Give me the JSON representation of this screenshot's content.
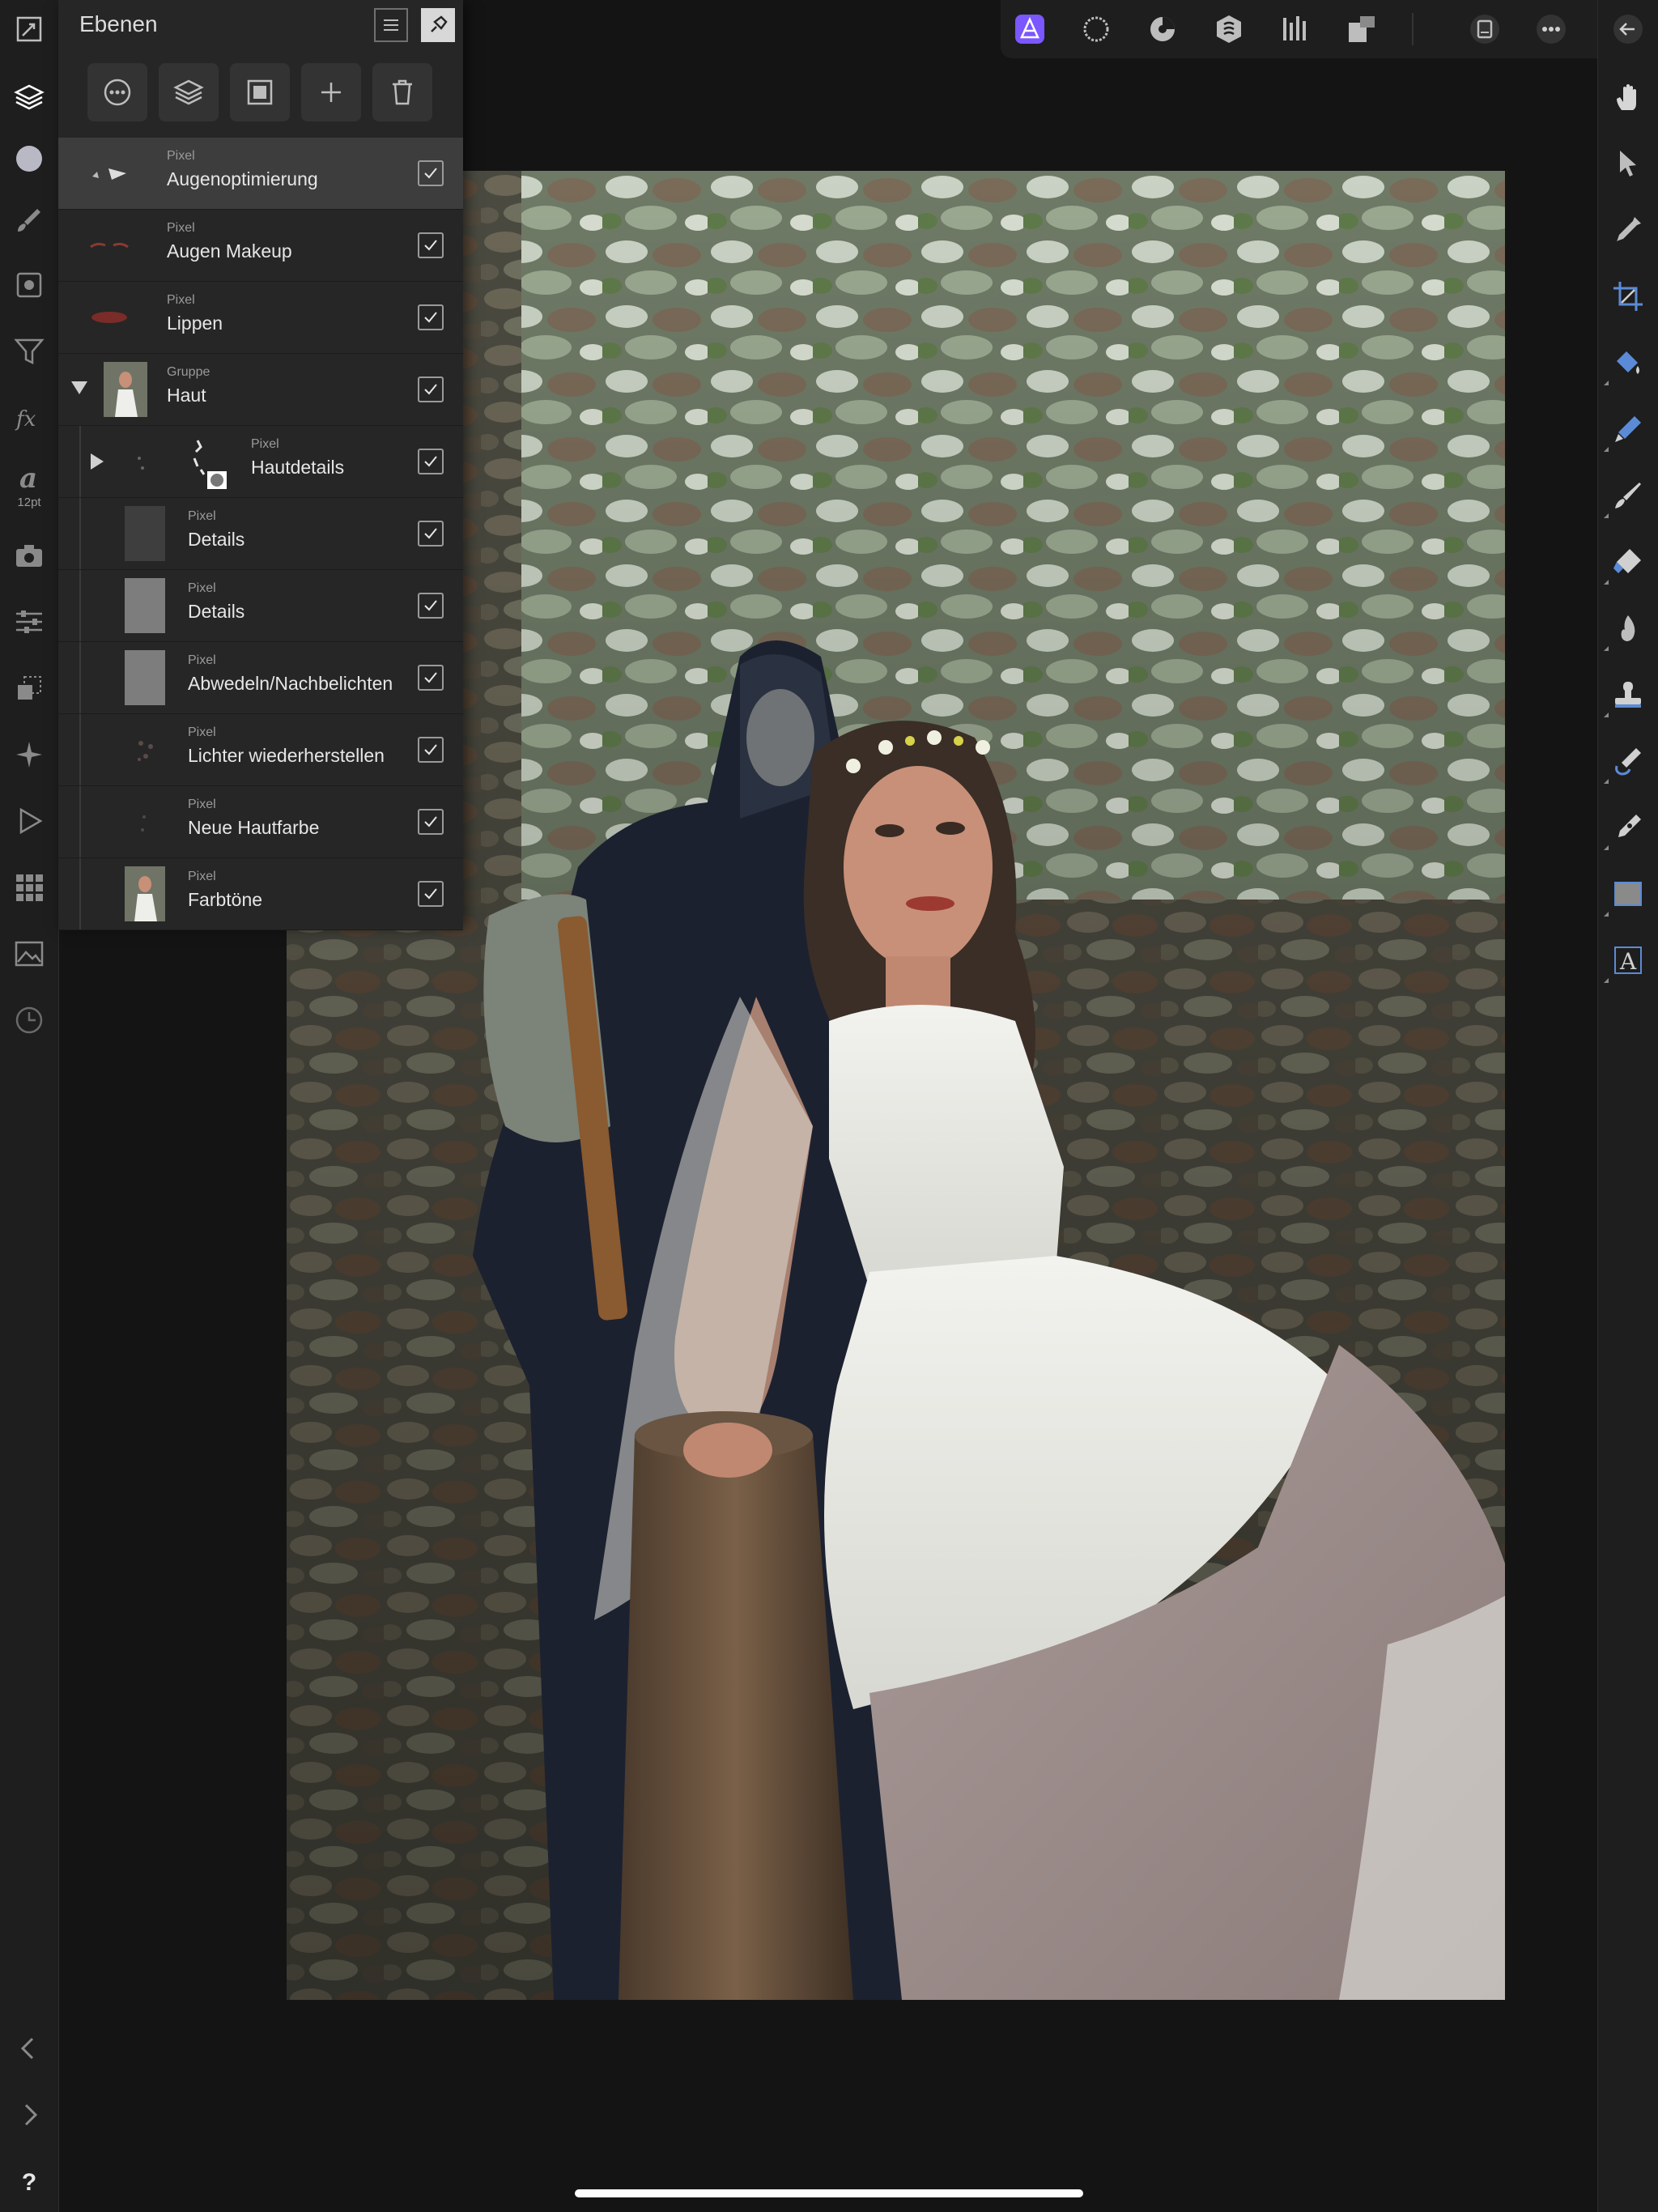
{
  "panel": {
    "title": "Ebenen",
    "layers": [
      {
        "type": "Pixel",
        "name": "Augenoptimierung",
        "visible": true,
        "selected": true
      },
      {
        "type": "Pixel",
        "name": "Augen Makeup",
        "visible": true
      },
      {
        "type": "Pixel",
        "name": "Lippen",
        "visible": true
      },
      {
        "type": "Gruppe",
        "name": "Haut",
        "visible": true,
        "expanded": true
      },
      {
        "type": "Pixel",
        "name": "Hautdetails",
        "visible": true,
        "collapsed": true
      },
      {
        "type": "Pixel",
        "name": "Details",
        "visible": true
      },
      {
        "type": "Pixel",
        "name": "Details",
        "visible": true
      },
      {
        "type": "Pixel",
        "name": "Abwedeln/Nachbelichten",
        "visible": true
      },
      {
        "type": "Pixel",
        "name": "Lichter wiederherstellen",
        "visible": true
      },
      {
        "type": "Pixel",
        "name": "Neue Hautfarbe",
        "visible": true
      },
      {
        "type": "Pixel",
        "name": "Farbtöne",
        "visible": true
      }
    ]
  },
  "left_toolbar": {
    "text_tool_size": "12pt"
  },
  "left_toolbar_icons": [
    "document-icon",
    "layers-icon",
    "color-circle-icon",
    "brush-icon",
    "adjust-icon",
    "filter-icon",
    "fx-icon",
    "text-style-icon",
    "camera-icon",
    "sliders-icon",
    "transform-icon",
    "navigator-icon",
    "play-icon",
    "grid-icon",
    "image-icon",
    "history-icon",
    "chevron-left-icon",
    "chevron-right-icon",
    "help-icon"
  ],
  "help_label": "?",
  "right_toolbar_icons": [
    "hand-icon",
    "move-icon",
    "color-picker-icon",
    "crop-icon",
    "fill-icon",
    "selection-brush-icon",
    "paint-brush-icon",
    "eraser-icon",
    "burn-icon",
    "clone-icon",
    "healing-icon",
    "pen-icon",
    "rectangle-icon",
    "artistic-text-icon",
    "back-icon"
  ],
  "top_bar_icons": [
    "photo-persona-icon",
    "liquify-persona-icon",
    "develop-persona-icon",
    "tone-map-persona-icon",
    "export-persona-icon",
    "studio-icon",
    "document-settings-icon",
    "more-icon"
  ],
  "colors": {
    "accent": "#7a57ff",
    "panel_bg": "#262626",
    "selected_row": "#3d3d3d"
  }
}
